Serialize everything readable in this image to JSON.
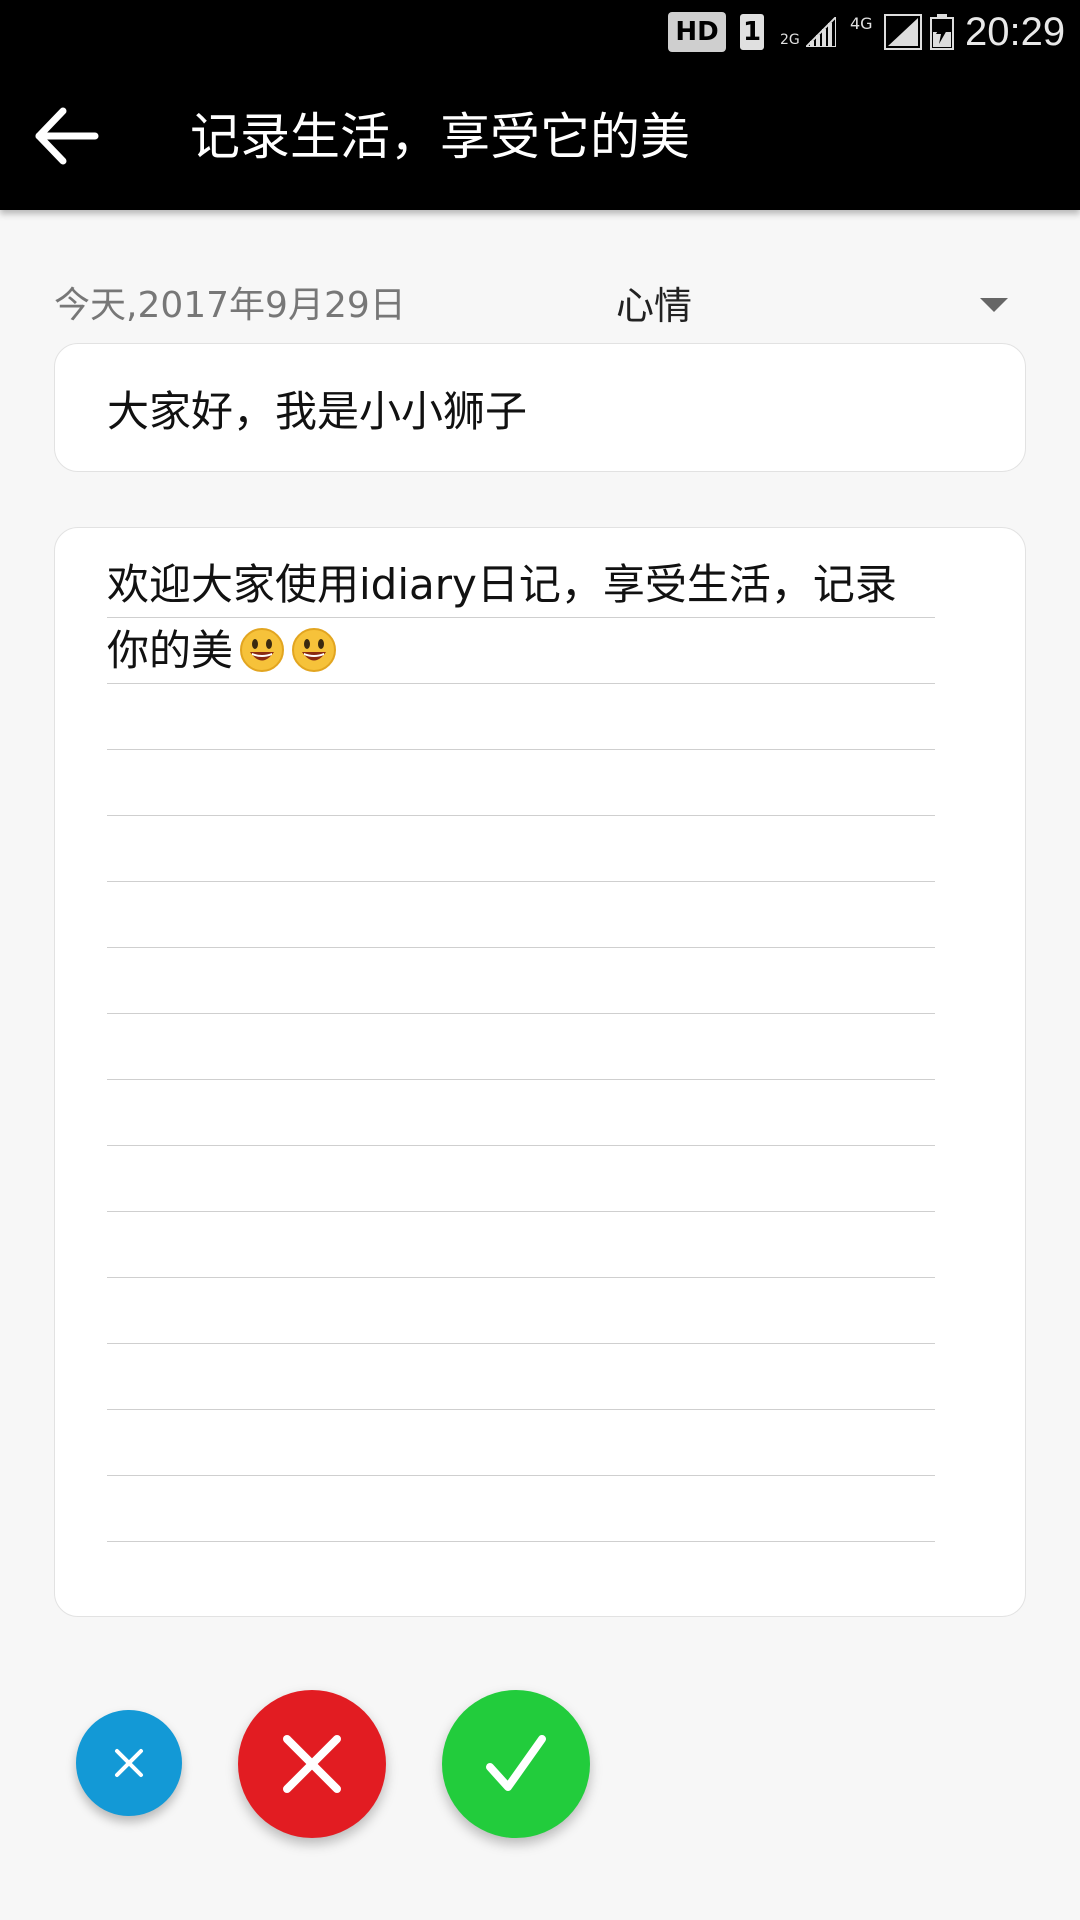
{
  "status_bar": {
    "hd": "HD",
    "sim": "1",
    "net_2g": "2G",
    "net_4g": "4G",
    "time": "20:29"
  },
  "app_bar": {
    "back_icon": "arrow-left-icon",
    "title": "记录生活，享受它的美"
  },
  "entry": {
    "date": "今天,2017年9月29日",
    "mood_label": "心情",
    "title_value": "大家好，我是小小狮子",
    "content_text": "欢迎大家使用idiary日记，享受生活，记录你的美",
    "emoji_icons": [
      "grinning-face-icon",
      "grinning-face-icon"
    ]
  },
  "actions": {
    "small_icon": "close-icon",
    "cancel_icon": "close-icon",
    "confirm_icon": "check-icon"
  },
  "colors": {
    "app_bar": "#000000",
    "background": "#f7f7f7",
    "small_fab": "#1399d6",
    "cancel_fab": "#e21c22",
    "confirm_fab": "#22cc3c"
  }
}
